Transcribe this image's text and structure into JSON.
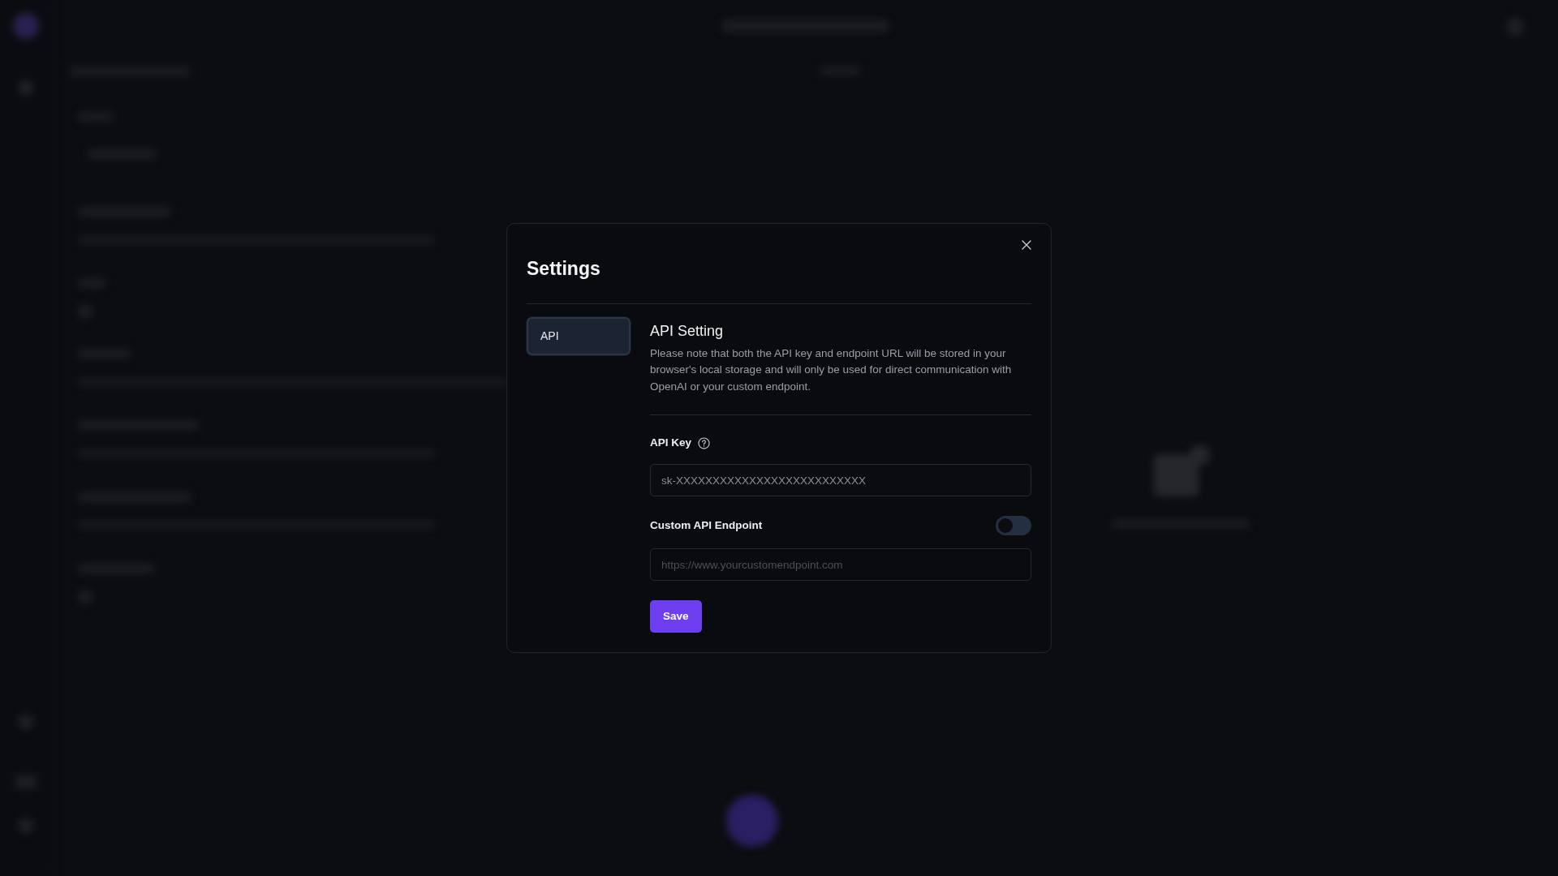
{
  "dialog": {
    "title": "Settings",
    "tabs": [
      {
        "label": "API",
        "selected": true
      }
    ],
    "section": {
      "title": "API Setting",
      "description": "Please note that both the API key and endpoint URL will be stored in your browser's local storage and will only be used for direct communication with OpenAI or your custom endpoint."
    },
    "api_key": {
      "label": "API Key",
      "placeholder": "sk-XXXXXXXXXXXXXXXXXXXXXXXXXX"
    },
    "custom_endpoint": {
      "label": "Custom API Endpoint",
      "on": false,
      "placeholder": "https://www.yourcustomendpoint.com"
    },
    "save": "Save"
  }
}
